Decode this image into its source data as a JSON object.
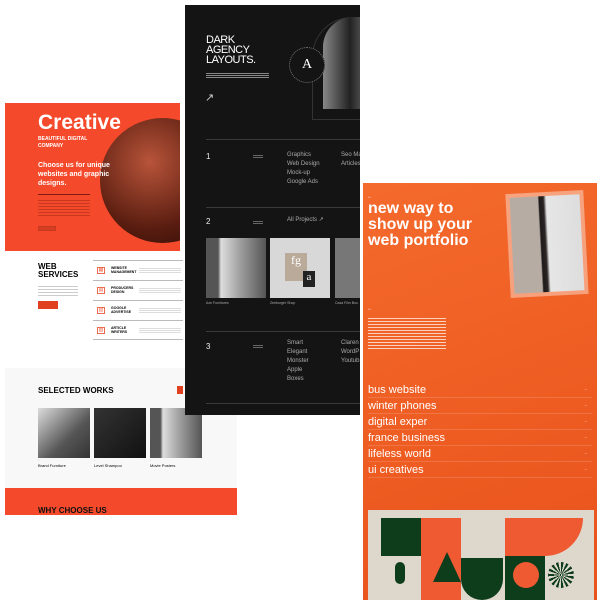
{
  "left_page": {
    "hero": {
      "title": "Creative",
      "subtitle": "BEAUTIFUL DIGITAL COMPANY",
      "tagline": "Choose us for unique websites and graphic designs."
    },
    "services": {
      "title": "WEB SERVICES",
      "items": [
        {
          "label": "WEBSITE MANAGEMENT"
        },
        {
          "label": "PRODUCERS DESIGN"
        },
        {
          "label": "GOOGLE ADVERTISE"
        },
        {
          "label": "ARTICLE WRITERS"
        }
      ]
    },
    "works": {
      "title": "SELECTED WORKS",
      "items": [
        "Brand Furniture",
        "Level Shampoo",
        "Movie Posters"
      ]
    },
    "why": {
      "title": "WHY CHOOSE US"
    },
    "accent": "#f4492a"
  },
  "dark_page": {
    "title": "DARK AGENCY LAYOUTS.",
    "badge_letter": "A",
    "sections": [
      {
        "num": "1",
        "col1": [
          "Graphics",
          "Web Design",
          "Mock-up",
          "Google Ads"
        ],
        "col2": [
          "Seo Manage",
          "Articles"
        ]
      },
      {
        "num": "2",
        "link": "All Projects ↗",
        "projects": [
          "Axe Furnitures",
          "Zeeburger Shop",
          "Casa Film Boo"
        ]
      },
      {
        "num": "3",
        "col1": [
          "Smart",
          "Elegant",
          "Monster",
          "Apple",
          "Boxes"
        ],
        "col2": [
          "Claren",
          "WordP",
          "Youtub"
        ]
      }
    ],
    "bg": "#141414"
  },
  "orange_page": {
    "title": "new way to show up your web portfolio",
    "projects": [
      "bus website",
      "winter phones",
      "digital exper",
      "france business",
      "lifeless world",
      "ui creatives"
    ],
    "bg": "#ee5a20"
  }
}
